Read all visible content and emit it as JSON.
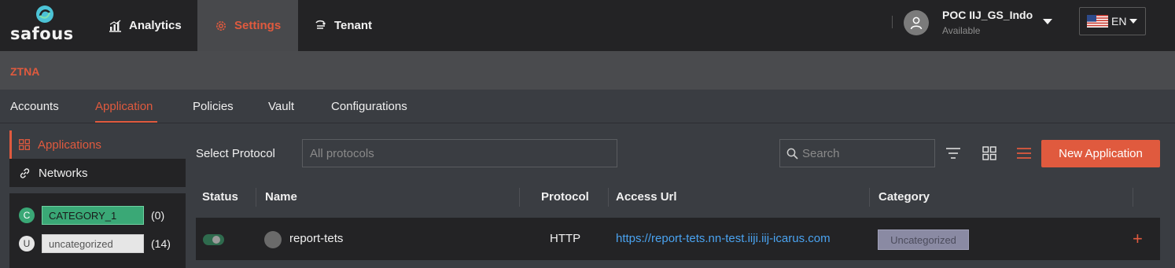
{
  "brand": {
    "name": "safous"
  },
  "topnav": {
    "items": [
      {
        "label": "Analytics",
        "icon": "chart-icon"
      },
      {
        "label": "Settings",
        "icon": "gear-icon",
        "active": true
      },
      {
        "label": "Tenant",
        "icon": "tenant-icon"
      }
    ]
  },
  "user": {
    "name": "POC IIJ_GS_Indo",
    "status": "Available"
  },
  "language": {
    "code": "EN",
    "flag": "us-flag-icon"
  },
  "section": {
    "title": "ZTNA"
  },
  "tabs": [
    {
      "label": "Accounts"
    },
    {
      "label": "Application",
      "active": true
    },
    {
      "label": "Policies"
    },
    {
      "label": "Vault"
    },
    {
      "label": "Configurations"
    }
  ],
  "sidebar": {
    "items": [
      {
        "label": "Applications",
        "icon": "grid-icon",
        "active": true
      },
      {
        "label": "Networks",
        "icon": "link-icon"
      }
    ],
    "categories": [
      {
        "initial": "C",
        "name": "CATEGORY_1",
        "count": "(0)",
        "color": "#3aa876"
      },
      {
        "initial": "U",
        "name": "uncategorized",
        "count": "(14)",
        "color": "#e6e6e6"
      }
    ]
  },
  "toolbar": {
    "protocol_label": "Select Protocol",
    "protocol_placeholder": "All protocols",
    "search_placeholder": "Search",
    "new_button": "New Application"
  },
  "table": {
    "columns": [
      "Status",
      "Name",
      "Protocol",
      "Access Url",
      "Category"
    ],
    "rows": [
      {
        "status": "enabled",
        "name": "report-tets",
        "protocol": "HTTP",
        "access_url": "https://report-tets.nn-test.iiji.iij-icarus.com",
        "category": "Uncategorized"
      }
    ]
  },
  "colors": {
    "accent": "#e05a3e",
    "link": "#4aa3f0",
    "topbar": "#232325"
  }
}
